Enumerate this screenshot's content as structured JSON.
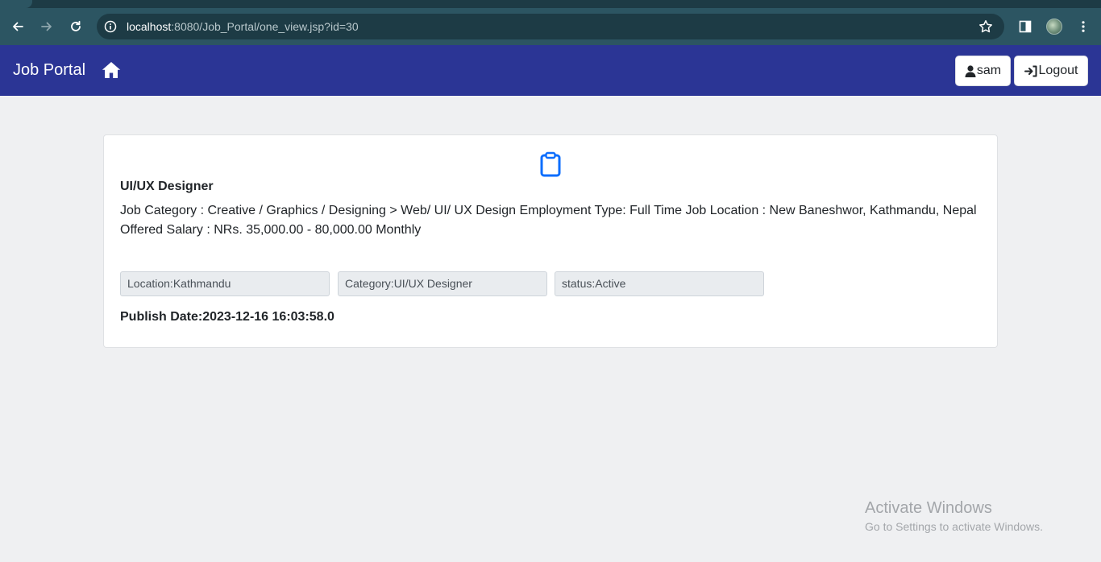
{
  "browser": {
    "url_host": "localhost",
    "url_rest": ":8080/Job_Portal/one_view.jsp?id=30",
    "icons": [
      "back-arrow-icon",
      "forward-arrow-icon",
      "reload-icon",
      "site-info-icon",
      "bookmark-star-icon",
      "side-panel-icon",
      "profile-avatar",
      "more-menu-icon"
    ]
  },
  "navbar": {
    "brand": "Job Portal",
    "home_icon": "home-icon",
    "user_label": "sam",
    "logout_label": "Logout",
    "background": "#2b3595"
  },
  "job": {
    "icon": "clipboard-icon",
    "title": "UI/UX Designer",
    "description": "Job Category : Creative / Graphics / Designing > Web/ UI/ UX Design Employment Type: Full Time Job Location : New Baneshwor, Kathmandu, Nepal Offered Salary : NRs. 35,000.00 - 80,000.00 Monthly",
    "location_field": "Location:Kathmandu",
    "category_field": "Category:UI/UX Designer",
    "status_field": "status:Active",
    "publish_date": "Publish Date:2023-12-16 16:03:58.0"
  },
  "watermark": {
    "title": "Activate Windows",
    "subtitle": "Go to Settings to activate Windows."
  },
  "colors": {
    "accent_icon": "#0d6efd",
    "page_bg": "#eff0f2",
    "chrome_bg": "#2c5562"
  }
}
